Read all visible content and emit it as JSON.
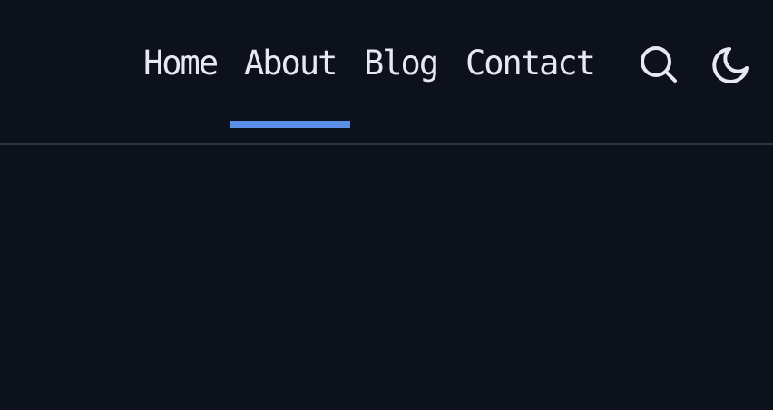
{
  "nav": {
    "items": [
      {
        "label": "Home"
      },
      {
        "label": "About"
      },
      {
        "label": "Blog"
      },
      {
        "label": "Contact"
      }
    ],
    "active": "About"
  },
  "icons": {
    "search": "search-icon",
    "theme_toggle": "moon-icon"
  },
  "colors": {
    "background": "#0d111b",
    "text": "#e6e9f2",
    "accent": "#5b8fea",
    "divider": "#2f3444"
  }
}
